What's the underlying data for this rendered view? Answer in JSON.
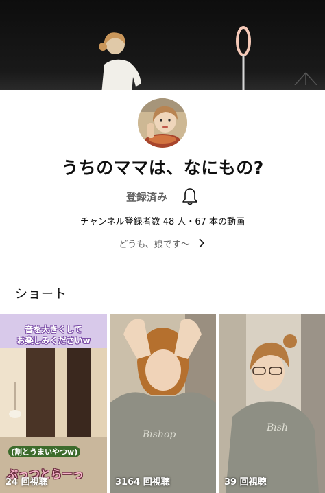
{
  "channel": {
    "name": "うちのママは、なにもの?",
    "subscribe_label": "登録済み",
    "stats": "チャンネル登録者数 48 人・67 本の動画",
    "description": "どうも、娘です〜"
  },
  "shorts_section": {
    "title": "ショート",
    "items": [
      {
        "views": "24 回視聴",
        "caption_top_1": "音を大きくして",
        "caption_top_2": "お楽しみくださいw",
        "caption_mid": "(割とうまいやつw)",
        "caption_bottom": "ぷっつとらーっ"
      },
      {
        "views": "3164 回視聴"
      },
      {
        "views": "39 回視聴"
      }
    ]
  },
  "colors": {
    "banner_bg": "#111111",
    "text_primary": "#0f0f0f",
    "text_secondary": "#606060"
  },
  "icons": {
    "bell": "bell-icon",
    "chevron": "chevron-right-icon"
  }
}
